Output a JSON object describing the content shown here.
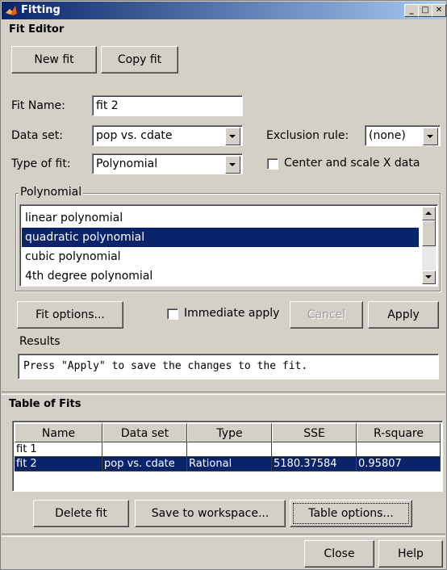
{
  "window": {
    "title": "Fitting"
  },
  "fit_editor": {
    "section_title": "Fit Editor",
    "new_fit_label": "New fit",
    "copy_fit_label": "Copy fit",
    "fit_name_label": "Fit Name:",
    "fit_name_value": "fit 2",
    "data_set_label": "Data set:",
    "data_set_value": "pop vs. cdate",
    "exclusion_rule_label": "Exclusion rule:",
    "exclusion_rule_value": "(none)",
    "type_of_fit_label": "Type of fit:",
    "type_of_fit_value": "Polynomial",
    "center_scale_label": "Center and scale X data",
    "center_scale_checked": false,
    "group_title": "Polynomial",
    "poly_items": [
      {
        "label": "linear polynomial",
        "selected": false
      },
      {
        "label": "quadratic polynomial",
        "selected": true
      },
      {
        "label": "cubic polynomial",
        "selected": false
      },
      {
        "label": "4th degree polynomial",
        "selected": false
      }
    ],
    "fit_options_label": "Fit options...",
    "immediate_apply_label": "Immediate apply",
    "immediate_apply_checked": false,
    "cancel_label": "Cancel",
    "apply_label": "Apply",
    "results_label": "Results",
    "results_text": "Press \"Apply\" to save the changes to the fit."
  },
  "table_of_fits": {
    "section_title": "Table of Fits",
    "columns": [
      "Name",
      "Data set",
      "Type",
      "SSE",
      "R-square"
    ],
    "rows": [
      {
        "cells": [
          "fit 1",
          "",
          "",
          "",
          ""
        ],
        "selected": false
      },
      {
        "cells": [
          "fit 2",
          "pop vs. cdate",
          "Rational",
          "5180.37584",
          "0.95807"
        ],
        "selected": true
      }
    ],
    "delete_fit_label": "Delete fit",
    "save_to_workspace_label": "Save to workspace...",
    "table_options_label": "Table options..."
  },
  "footer": {
    "close_label": "Close",
    "help_label": "Help"
  },
  "colors": {
    "selection": "#0a246a",
    "face": "#d4d0c8",
    "title_start": "#0a246a",
    "title_end": "#a6caf0"
  }
}
